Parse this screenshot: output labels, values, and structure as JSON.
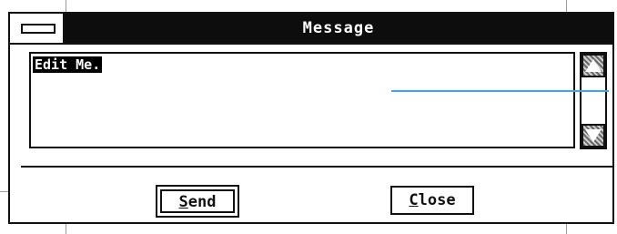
{
  "window": {
    "title": "Message"
  },
  "editor": {
    "text": "Edit Me."
  },
  "buttons": {
    "send": {
      "mnemonic": "S",
      "rest": "end"
    },
    "close": {
      "mnemonic": "C",
      "rest": "lose"
    }
  },
  "icons": {
    "system_menu": "system-menu-icon",
    "scroll_up": "scroll-up-arrow-icon",
    "scroll_down": "scroll-down-arrow-icon"
  },
  "colors": {
    "titlebar": "#0d0d0d",
    "title_text": "#ffffff",
    "selection": "#000000",
    "stray_line": "#3aa9e0"
  }
}
